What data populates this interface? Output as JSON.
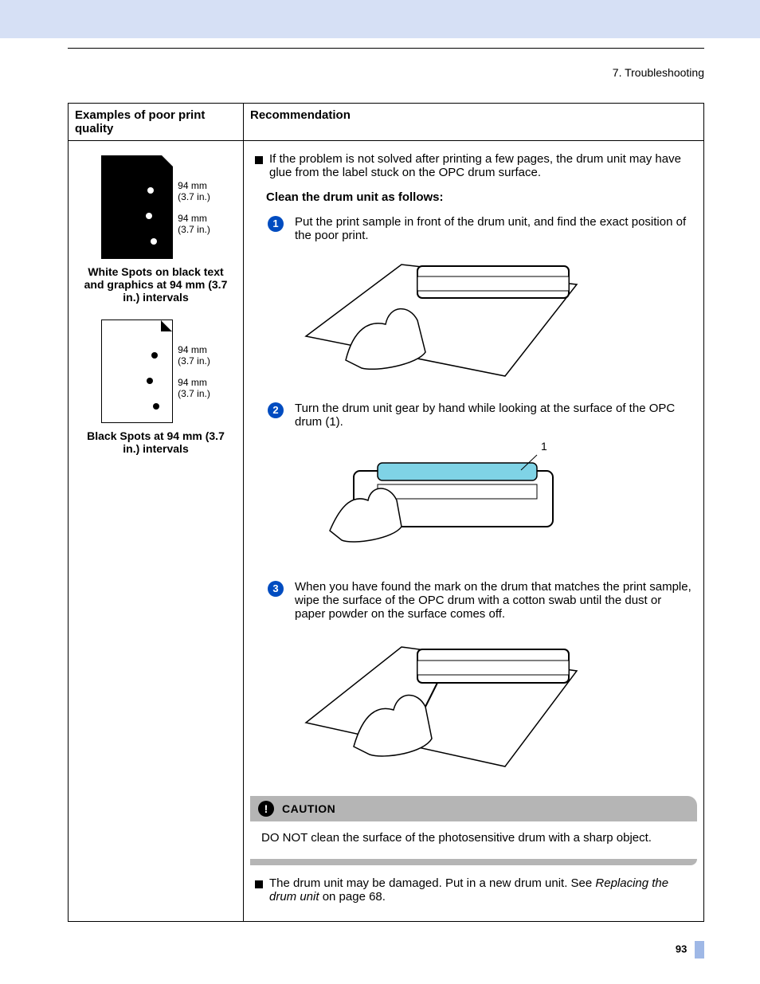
{
  "header": {
    "section": "7. Troubleshooting"
  },
  "table": {
    "headers": {
      "left": "Examples of poor print quality",
      "right": "Recommendation"
    },
    "left": {
      "measure1": "94 mm",
      "measure1b": "(3.7 in.)",
      "measure2": "94 mm",
      "measure2b": "(3.7 in.)",
      "caption1": "White Spots on black text and graphics at 94 mm (3.7 in.) intervals",
      "measure3": "94 mm",
      "measure3b": "(3.7 in.)",
      "measure4": "94 mm",
      "measure4b": "(3.7 in.)",
      "caption2": "Black Spots at 94 mm (3.7 in.) intervals"
    },
    "right": {
      "bullet1": "If the problem is not solved after printing a few pages, the drum unit may have glue from the label stuck on the OPC drum surface.",
      "clean_heading": "Clean the drum unit as follows:",
      "steps": [
        {
          "n": "1",
          "text": "Put the print sample in front of the drum unit, and find the exact position of the poor print."
        },
        {
          "n": "2",
          "text": "Turn the drum unit gear by hand while looking at the surface of the OPC drum (1)."
        },
        {
          "n": "3",
          "text": "When you have found the mark on the drum that matches the print sample, wipe the surface of the OPC drum with a cotton swab until the dust or paper powder on the surface comes off."
        }
      ],
      "callout_1": "1",
      "caution": {
        "label": "CAUTION",
        "text": "DO NOT clean the surface of the photosensitive drum with a sharp object."
      },
      "bullet2_a": "The drum unit may be damaged. Put in a new drum unit. See ",
      "bullet2_italic": "Replacing the drum unit",
      "bullet2_b": " on page 68."
    }
  },
  "footer": {
    "page": "93"
  }
}
